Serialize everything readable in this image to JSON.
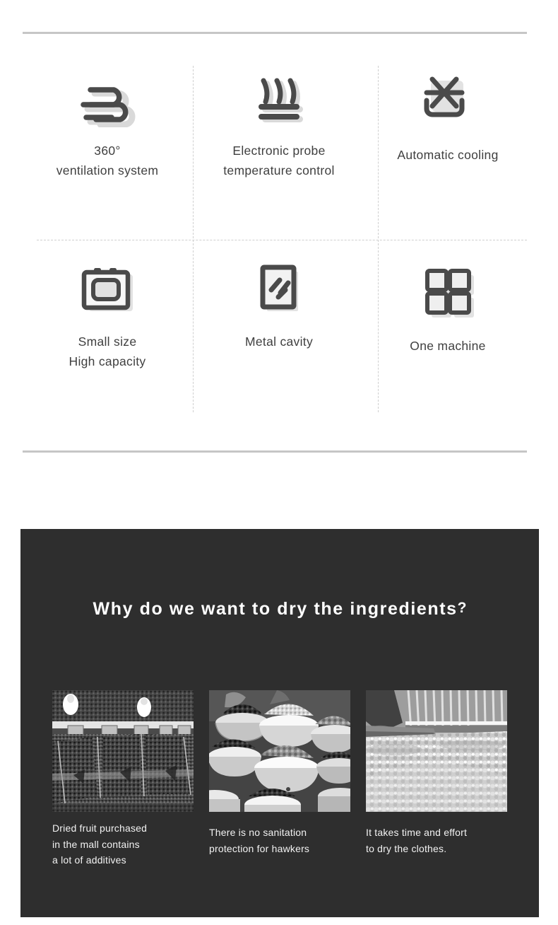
{
  "features": {
    "items": [
      {
        "icon": "wind-ventilation-icon",
        "label": "360°\nventilation system"
      },
      {
        "icon": "heat-probe-icon",
        "label": "Electronic probe\ntemperature control"
      },
      {
        "icon": "snowflake-cooling-icon",
        "label": "Automatic cooling"
      },
      {
        "icon": "appliance-oven-icon",
        "label": "Small size\nHigh capacity"
      },
      {
        "icon": "metal-cavity-panel-icon",
        "label": "Metal cavity"
      },
      {
        "icon": "four-squares-grid-icon",
        "label": "One machine"
      }
    ],
    "divider_color": "#c6c6c6",
    "dash_color": "#cfcfcf",
    "label_color": "#3f3f3f"
  },
  "dark_section": {
    "background": "#2e2e2e",
    "title_main": "Why do we want to dry the ingredients",
    "title_mark": "?",
    "title_color": "#ffffff",
    "photos": [
      {
        "alt": "market-dried-fruit-bins-photo",
        "caption": "Dried fruit purchased\nin the mall contains\na lot of additives"
      },
      {
        "alt": "market-bowls-of-nuts-photo",
        "caption": "There is no sanitation\nprotection for hawkers"
      },
      {
        "alt": "outdoor-sun-drying-produce-photo",
        "caption": "It takes time and effort\nto dry the clothes."
      }
    ],
    "caption_color": "#f2f2f2"
  }
}
